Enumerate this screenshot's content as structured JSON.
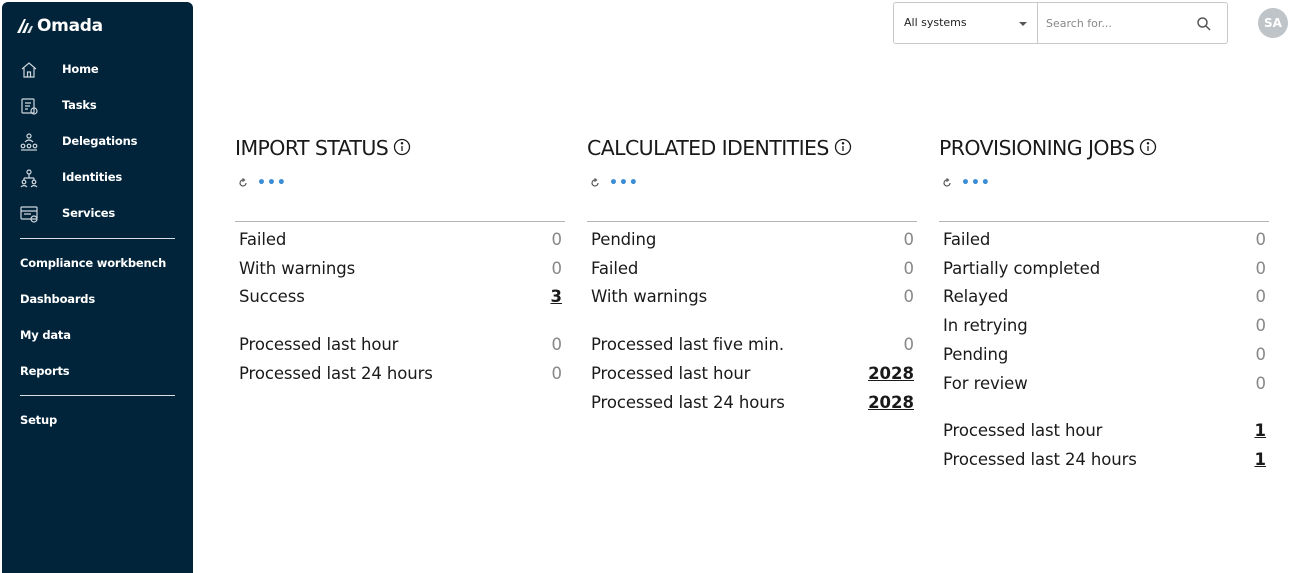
{
  "app": {
    "logo_text": "Omada"
  },
  "sidebar": {
    "items": [
      {
        "label": "Home",
        "icon": "home-icon"
      },
      {
        "label": "Tasks",
        "icon": "tasks-icon"
      },
      {
        "label": "Delegations",
        "icon": "delegations-icon"
      },
      {
        "label": "Identities",
        "icon": "identities-icon"
      },
      {
        "label": "Services",
        "icon": "services-icon"
      }
    ],
    "links": [
      {
        "label": "Compliance workbench"
      },
      {
        "label": "Dashboards"
      },
      {
        "label": "My data"
      },
      {
        "label": "Reports"
      }
    ],
    "setup": {
      "label": "Setup"
    }
  },
  "header": {
    "system_select": {
      "value": "All systems"
    },
    "search": {
      "placeholder": "Search for..."
    },
    "avatar": {
      "initials": "SA"
    }
  },
  "panels": [
    {
      "title": "IMPORT STATUS",
      "status_rows": [
        {
          "label": "Failed",
          "value": "0",
          "link": false
        },
        {
          "label": "With warnings",
          "value": "0",
          "link": false
        },
        {
          "label": "Success",
          "value": "3",
          "link": true
        }
      ],
      "processed_rows": [
        {
          "label": "Processed last hour",
          "value": "0",
          "link": false
        },
        {
          "label": "Processed last 24 hours",
          "value": "0",
          "link": false
        }
      ]
    },
    {
      "title": "CALCULATED IDENTITIES",
      "status_rows": [
        {
          "label": "Pending",
          "value": "0",
          "link": false
        },
        {
          "label": "Failed",
          "value": "0",
          "link": false
        },
        {
          "label": "With warnings",
          "value": "0",
          "link": false
        }
      ],
      "processed_rows": [
        {
          "label": "Processed last five min.",
          "value": "0",
          "link": false
        },
        {
          "label": "Processed last hour",
          "value": "2028",
          "link": true
        },
        {
          "label": "Processed last 24 hours",
          "value": "2028",
          "link": true
        }
      ]
    },
    {
      "title": "PROVISIONING JOBS",
      "status_rows": [
        {
          "label": "Failed",
          "value": "0",
          "link": false
        },
        {
          "label": "Partially completed",
          "value": "0",
          "link": false
        },
        {
          "label": "Relayed",
          "value": "0",
          "link": false
        },
        {
          "label": "In retrying",
          "value": "0",
          "link": false
        },
        {
          "label": "Pending",
          "value": "0",
          "link": false
        },
        {
          "label": "For review",
          "value": "0",
          "link": false
        }
      ],
      "processed_rows": [
        {
          "label": "Processed last hour",
          "value": "1",
          "link": true
        },
        {
          "label": "Processed last 24 hours",
          "value": "1",
          "link": true
        }
      ]
    }
  ],
  "colors": {
    "sidebar_bg": "#02243a",
    "accent": "#3b8dd4",
    "muted_value": "#888888"
  }
}
